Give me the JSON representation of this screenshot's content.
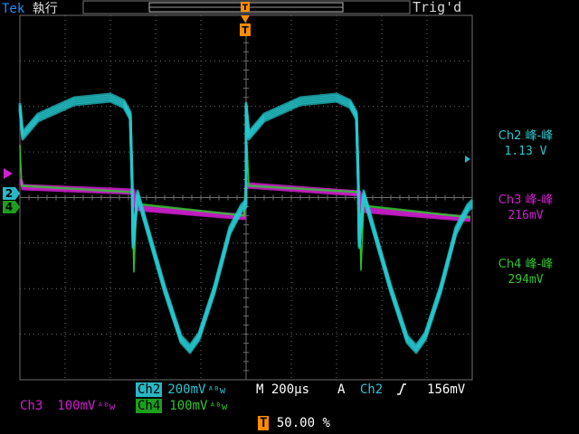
{
  "header": {
    "brand": "Tek",
    "run_state": "執行",
    "trigger_status": "Trig'd",
    "trigger_marker": "T"
  },
  "measurements": [
    {
      "label": "Ch2 峰-峰",
      "value": "1.13 V",
      "color": "#25c9cf"
    },
    {
      "label": "Ch3 峰-峰",
      "value": "216mV",
      "color": "#d21fd2"
    },
    {
      "label": "Ch4 峰-峰",
      "value": "294mV",
      "color": "#2fc62f"
    }
  ],
  "channel_markers": {
    "ch2": "2",
    "ch4": "4"
  },
  "readouts": {
    "ch2": {
      "name": "Ch2",
      "scale": "200mV",
      "coupling": "ᴬᴮw"
    },
    "ch3": {
      "name": "Ch3",
      "scale": "100mV",
      "coupling": "ᴬᴮw"
    },
    "ch4": {
      "name": "Ch4",
      "scale": "100mV",
      "coupling": "ᴬᴮw"
    },
    "timebase_prefix": "M",
    "timebase": "200µs",
    "trigger_mode": "A",
    "trigger_source": "Ch2",
    "trigger_slope_icon": "rising-edge-icon",
    "trigger_level": "156mV",
    "trigger_position_marker": "T",
    "trigger_position": "50.00 %"
  },
  "colors": {
    "ch2": "#25c9cf",
    "ch3": "#d21fd2",
    "ch4": "#2fc62f",
    "trigger": "#ff8c00",
    "grid": "#6e6e6e"
  }
}
